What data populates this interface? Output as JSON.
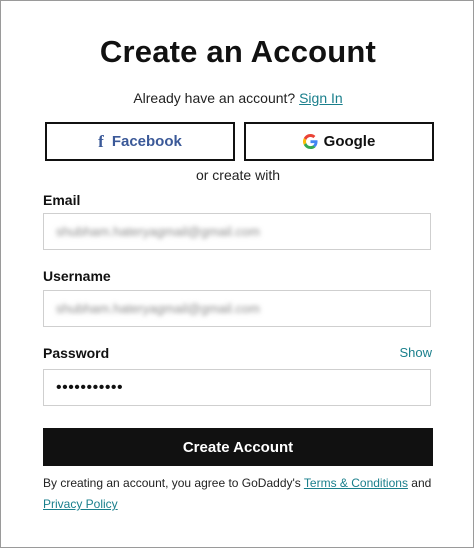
{
  "title": "Create an Account",
  "signin": {
    "prompt": "Already have an account?",
    "link": "Sign In"
  },
  "social": {
    "facebook_icon": "f",
    "facebook_label": "Facebook",
    "google_label": "Google"
  },
  "divider_text": "or create with",
  "email": {
    "label": "Email",
    "value": "shubham.hateryagmail@gmail.com"
  },
  "username": {
    "label": "Username",
    "value": "shubham.hateryagmail@gmail.com"
  },
  "password": {
    "label": "Password",
    "show_label": "Show",
    "value": "•••••••••••"
  },
  "submit_label": "Create Account",
  "terms": {
    "prefix": "By creating an account, you agree to GoDaddy's",
    "terms_link": "Terms & Conditions",
    "and": "and",
    "privacy_link": "Privacy Policy"
  },
  "colors": {
    "accent": "#1a7f8c",
    "facebook": "#3b5998",
    "button": "#111111"
  },
  "icons": [
    "facebook-icon",
    "google-icon"
  ]
}
